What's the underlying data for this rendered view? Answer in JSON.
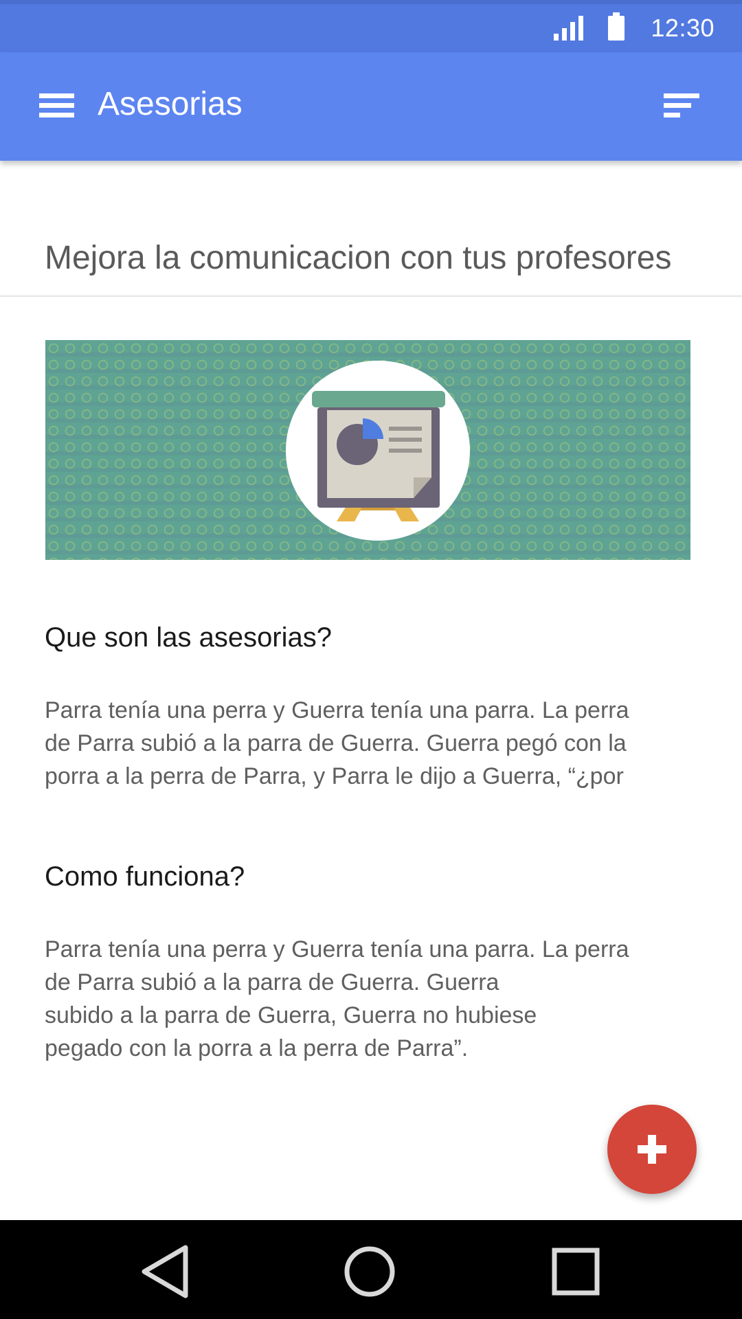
{
  "status_bar": {
    "time": "12:30",
    "icons": [
      "signal-icon",
      "battery-icon"
    ]
  },
  "app_bar": {
    "title": "Asesorias",
    "menu_icon": "menu-icon",
    "sort_icon": "sort-icon",
    "color": "#5c85f0"
  },
  "content": {
    "subheader": "Mejora la comunicacion con tus profesores",
    "hero_icon": "presentation-board-icon",
    "sections": [
      {
        "title": "Que son las asesorias?",
        "body": "Parra tenía una perra y Guerra tenía una parra. La perra\nde Parra subió a la parra de Guerra. Guerra pegó con la\n porra a la perra de Parra, y Parra le dijo a Guerra, “¿por"
      },
      {
        "title": "Como funciona?",
        "body": "Parra tenía una perra y Guerra tenía una parra. La perra\nde Parra subió a la parra de Guerra. Guerra\nsubido a la parra de Guerra, Guerra no hubiese\npegado con la porra a la perra de Parra”."
      }
    ]
  },
  "fab": {
    "icon": "plus-icon",
    "color": "#d4453a"
  },
  "nav_bar": {
    "icons": [
      "back-icon",
      "home-icon",
      "recents-icon"
    ]
  }
}
